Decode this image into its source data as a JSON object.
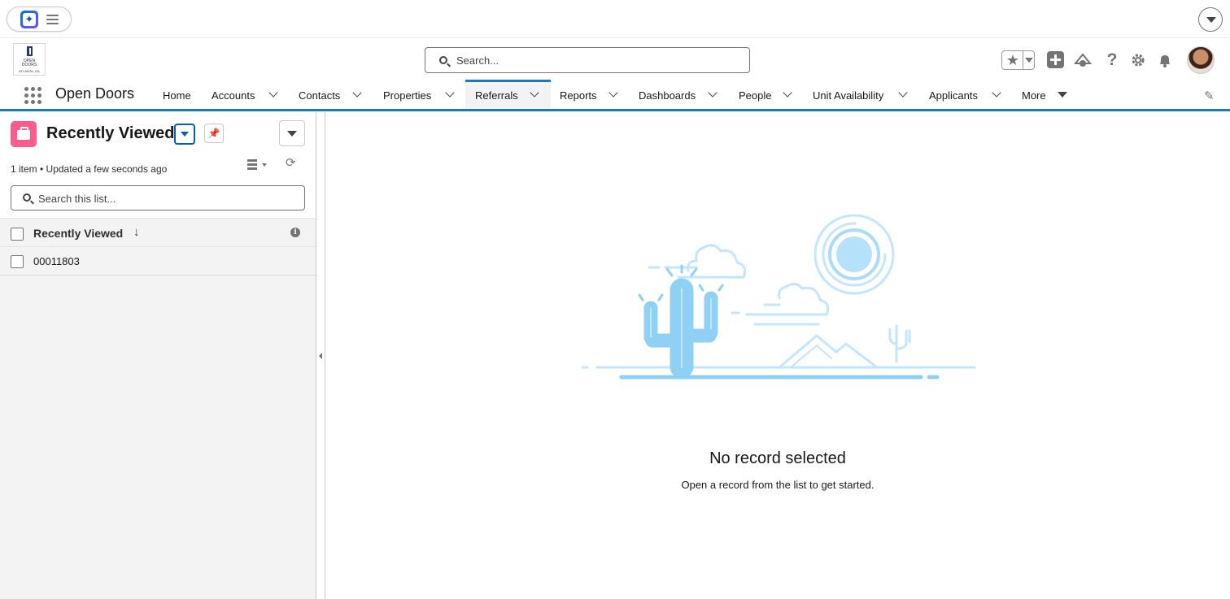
{
  "app": {
    "name": "Open Doors"
  },
  "logo": {
    "lines": [
      "OPEN",
      "DOORS",
      "ATLANTA, GA"
    ]
  },
  "search": {
    "placeholder": "Search..."
  },
  "nav": {
    "tabs": [
      {
        "label": "Home",
        "dropdown": false
      },
      {
        "label": "Accounts",
        "dropdown": true
      },
      {
        "label": "Contacts",
        "dropdown": true
      },
      {
        "label": "Properties",
        "dropdown": true
      },
      {
        "label": "Referrals",
        "dropdown": true,
        "active": true
      },
      {
        "label": "Reports",
        "dropdown": true
      },
      {
        "label": "Dashboards",
        "dropdown": true
      },
      {
        "label": "People",
        "dropdown": true
      },
      {
        "label": "Unit Availability",
        "dropdown": true
      },
      {
        "label": "Applicants",
        "dropdown": true
      },
      {
        "label": "More",
        "dropdown": true
      }
    ]
  },
  "header_icons": [
    "favorites-star-icon",
    "global-actions-plus-icon",
    "trailhead-icon",
    "help-icon",
    "setup-gear-icon",
    "notifications-bell-icon",
    "user-avatar"
  ],
  "list_view": {
    "title": "Recently Viewed",
    "meta": "1 item • Updated a few seconds ago",
    "search_placeholder": "Search this list...",
    "column_header": "Recently Viewed",
    "sort_indicator": "↓",
    "rows": [
      {
        "value": "00011803"
      }
    ]
  },
  "empty_state": {
    "title": "No record selected",
    "subtitle": "Open a record from the list to get started."
  },
  "colors": {
    "accent": "#1b77c6",
    "object_icon": "#fc5c8d",
    "illustration": "#8fd0f5"
  }
}
